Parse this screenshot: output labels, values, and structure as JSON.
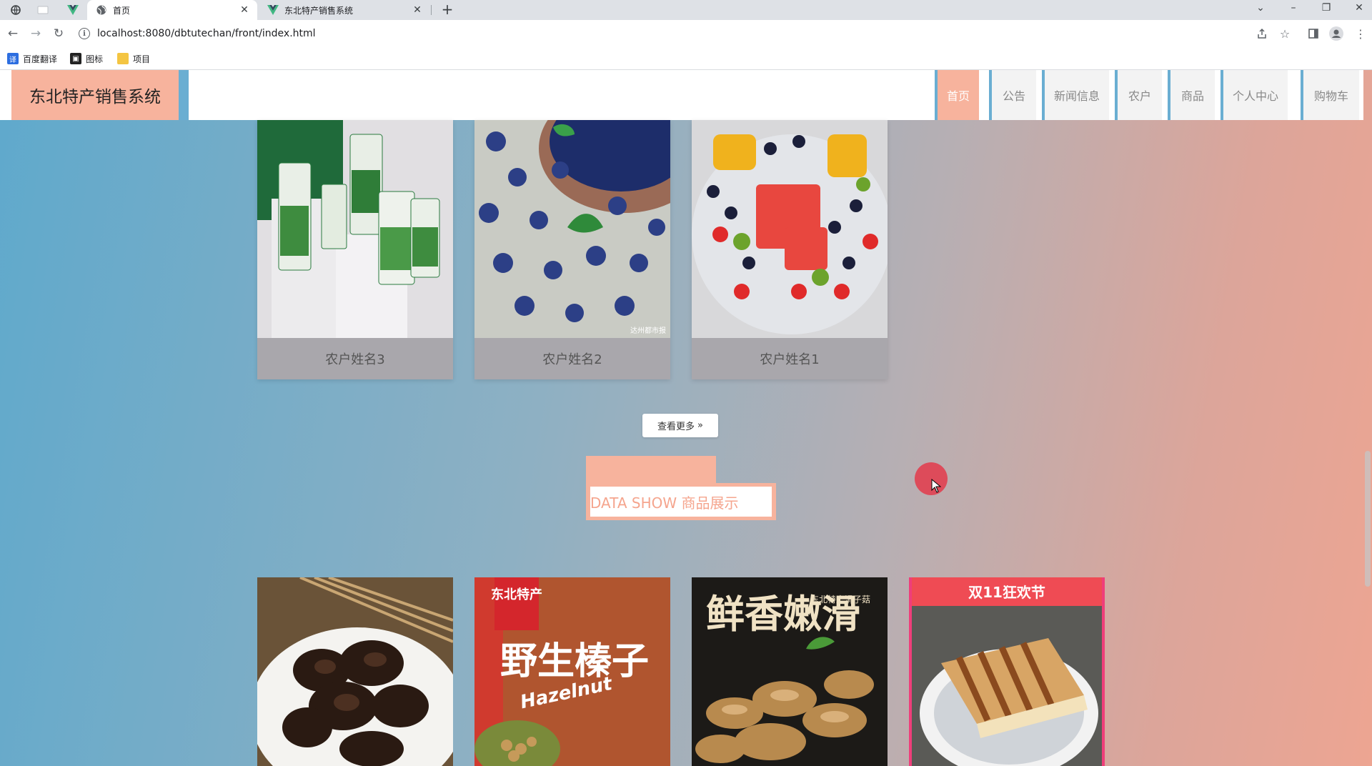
{
  "browser": {
    "tabs": [
      {
        "title": "首页",
        "active": true
      },
      {
        "title": "东北特产销售系统",
        "active": false
      }
    ],
    "url": "localhost:8080/dbtutechan/front/index.html",
    "bookmarks": [
      {
        "label": "百度翻译",
        "icon": "baidu-translate-icon"
      },
      {
        "label": "图标",
        "icon": "image-icon"
      },
      {
        "label": "项目",
        "icon": "folder-icon"
      }
    ]
  },
  "site": {
    "title": "东北特产销售系统",
    "nav": [
      {
        "label": "首页",
        "active": true
      },
      {
        "label": "公告"
      },
      {
        "label": "新闻信息"
      },
      {
        "label": "农户"
      },
      {
        "label": "商品"
      },
      {
        "label": "个人中心"
      },
      {
        "label": "购物车"
      }
    ]
  },
  "farmers": {
    "cards": [
      {
        "name": "农户姓名3",
        "image": "green-tea-packages"
      },
      {
        "name": "农户姓名2",
        "image": "blueberries-bowl"
      },
      {
        "name": "农户姓名1",
        "image": "fruit-platter"
      }
    ],
    "watermark": "达州都市报",
    "more_label": "查看更多"
  },
  "products": {
    "section_title": "DATA SHOW 商品展示",
    "items": [
      {
        "image": "black-fungus"
      },
      {
        "image": "wild-hazelnut",
        "badge": "东北特产",
        "headline": "野生榛子",
        "subtitle": "Hazelnut"
      },
      {
        "image": "slippery-mushroom",
        "headline": "鲜香嫩滑",
        "note": "东北特产滑子菇"
      },
      {
        "image": "roasted-tofu-skin",
        "banner": "双11狂欢节"
      }
    ]
  },
  "colors": {
    "accent": "#f7b39d",
    "stripe": "#6aaed2",
    "bg_left": "#5fa9cc",
    "bg_right": "#eda592"
  }
}
